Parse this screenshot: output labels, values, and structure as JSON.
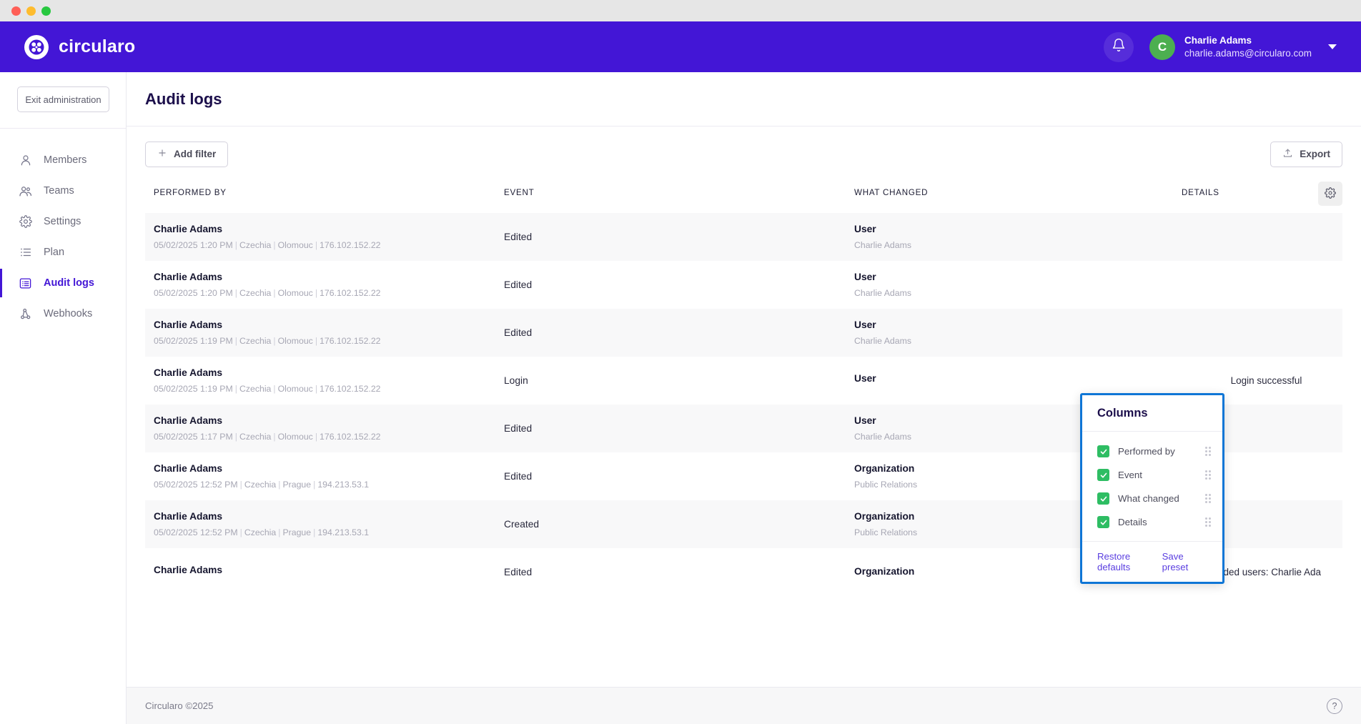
{
  "window": {
    "traffic_lights": [
      "close",
      "minimize",
      "maximize"
    ]
  },
  "topbar": {
    "brand_name": "circularo",
    "notifications_icon": "bell-icon",
    "user": {
      "initial": "C",
      "name": "Charlie Adams",
      "email": "charlie.adams@circularo.com"
    },
    "accent_color": "#4316d6"
  },
  "sidebar": {
    "exit_label": "Exit administration",
    "items": [
      {
        "label": "Members",
        "icon": "user-icon",
        "active": false
      },
      {
        "label": "Teams",
        "icon": "users-icon",
        "active": false
      },
      {
        "label": "Settings",
        "icon": "gear-icon",
        "active": false
      },
      {
        "label": "Plan",
        "icon": "list-icon",
        "active": false
      },
      {
        "label": "Audit logs",
        "icon": "logs-icon",
        "active": true
      },
      {
        "label": "Webhooks",
        "icon": "webhook-icon",
        "active": false
      }
    ]
  },
  "page": {
    "title": "Audit logs"
  },
  "toolbar": {
    "add_filter_label": "Add filter",
    "add_filter_icon": "plus-icon",
    "export_label": "Export",
    "export_icon": "upload-icon"
  },
  "table": {
    "headers": [
      "PERFORMED BY",
      "EVENT",
      "WHAT CHANGED",
      "DETAILS"
    ],
    "settings_icon": "gear-icon",
    "rows": [
      {
        "performed_by": "Charlie Adams",
        "meta_date": "05/02/2025 1:20 PM",
        "meta_country": "Czechia",
        "meta_city": "Olomouc",
        "meta_ip": "176.102.152.22",
        "event": "Edited",
        "changed_type": "User",
        "changed_name": "Charlie Adams",
        "details": ""
      },
      {
        "performed_by": "Charlie Adams",
        "meta_date": "05/02/2025 1:20 PM",
        "meta_country": "Czechia",
        "meta_city": "Olomouc",
        "meta_ip": "176.102.152.22",
        "event": "Edited",
        "changed_type": "User",
        "changed_name": "Charlie Adams",
        "details": ""
      },
      {
        "performed_by": "Charlie Adams",
        "meta_date": "05/02/2025 1:19 PM",
        "meta_country": "Czechia",
        "meta_city": "Olomouc",
        "meta_ip": "176.102.152.22",
        "event": "Edited",
        "changed_type": "User",
        "changed_name": "Charlie Adams",
        "details": ""
      },
      {
        "performed_by": "Charlie Adams",
        "meta_date": "05/02/2025 1:19 PM",
        "meta_country": "Czechia",
        "meta_city": "Olomouc",
        "meta_ip": "176.102.152.22",
        "event": "Login",
        "changed_type": "User",
        "changed_name": "",
        "details": "Login successful"
      },
      {
        "performed_by": "Charlie Adams",
        "meta_date": "05/02/2025 1:17 PM",
        "meta_country": "Czechia",
        "meta_city": "Olomouc",
        "meta_ip": "176.102.152.22",
        "event": "Edited",
        "changed_type": "User",
        "changed_name": "Charlie Adams",
        "details": ""
      },
      {
        "performed_by": "Charlie Adams",
        "meta_date": "05/02/2025 12:52 PM",
        "meta_country": "Czechia",
        "meta_city": "Prague",
        "meta_ip": "194.213.53.1",
        "event": "Edited",
        "changed_type": "Organization",
        "changed_name": "Public Relations",
        "details": ""
      },
      {
        "performed_by": "Charlie Adams",
        "meta_date": "05/02/2025 12:52 PM",
        "meta_country": "Czechia",
        "meta_city": "Prague",
        "meta_ip": "194.213.53.1",
        "event": "Created",
        "changed_type": "Organization",
        "changed_name": "Public Relations",
        "details": ""
      },
      {
        "performed_by": "Charlie Adams",
        "meta_date": "",
        "meta_country": "",
        "meta_city": "",
        "meta_ip": "",
        "event": "Edited",
        "changed_type": "Organization",
        "changed_name": "",
        "details": "Added users: Charlie Ada"
      }
    ]
  },
  "columns_popover": {
    "title": "Columns",
    "highlight_color": "#0f76d6",
    "checkbox_color": "#2ebd63",
    "items": [
      {
        "label": "Performed by",
        "checked": true
      },
      {
        "label": "Event",
        "checked": true
      },
      {
        "label": "What changed",
        "checked": true
      },
      {
        "label": "Details",
        "checked": true
      }
    ],
    "restore_label": "Restore defaults",
    "save_label": "Save preset"
  },
  "footer": {
    "copyright": "Circularo ©2025",
    "help_icon": "question-icon",
    "help_label": "?"
  }
}
